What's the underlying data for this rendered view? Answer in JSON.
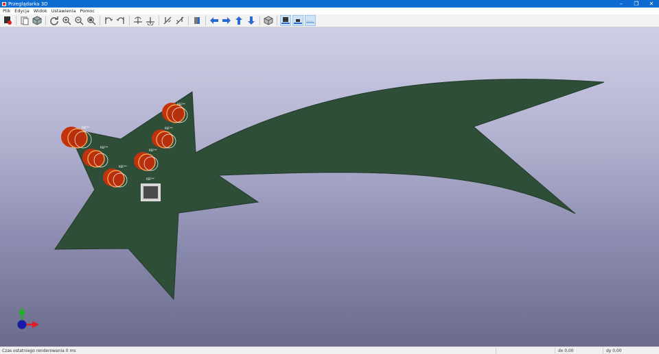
{
  "window": {
    "title": "Przeglądarka 3D",
    "minimize": "–",
    "restore": "❐",
    "close": "✕"
  },
  "menu": [
    "Plik",
    "Edycja",
    "Widok",
    "Ustawienia",
    "Pomoc"
  ],
  "toolbar": {
    "buttons": [
      "render-icon",
      "copy-image-icon",
      "cube-icon",
      "reload-icon",
      "zoom-in-icon",
      "zoom-out-icon",
      "zoom-fit-icon",
      "rotate-x-cw-icon",
      "rotate-x-ccw-icon",
      "rotate-y-cw-icon",
      "rotate-y-ccw-icon",
      "rotate-z-cw-icon",
      "rotate-z-ccw-icon",
      "flip-board-icon",
      "pan-left-icon",
      "pan-right-icon",
      "pan-up-icon",
      "pan-down-icon",
      "ortho-cube-icon",
      "view-top-icon",
      "view-bottom-icon",
      "view-side-icon"
    ]
  },
  "board": {
    "component_label": "REF**",
    "colors": {
      "pcb": "#2e4e38",
      "led": "#c2320c",
      "led_dark": "#7a1a05",
      "chip": "#4a4a4a"
    }
  },
  "status": {
    "render_time": "Czas ostatniego renderowania 0 ms",
    "dx": "dx 0,00",
    "dy": "dy 0,00"
  }
}
